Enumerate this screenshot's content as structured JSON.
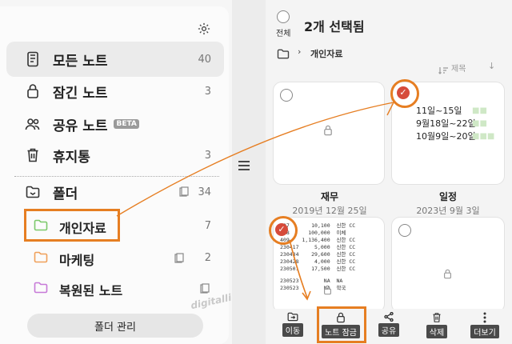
{
  "sidebar": {
    "items": [
      {
        "label": "모든 노트",
        "count": "40"
      },
      {
        "label": "잠긴 노트",
        "count": "3"
      },
      {
        "label": "공유 노트",
        "badge": "BETA"
      },
      {
        "label": "휴지통",
        "count": "3"
      }
    ],
    "folders_label": "폴더",
    "folders_count": "34",
    "folders": [
      {
        "label": "개인자료",
        "count": "7",
        "color": "#7cc96b"
      },
      {
        "label": "마케팅",
        "count": "2",
        "color": "#f0a05a"
      },
      {
        "label": "복원된 노트",
        "count": "",
        "color": "#c77ad8"
      }
    ],
    "manage_button": "폴더 관리"
  },
  "header": {
    "select_all": "전체",
    "title": "2개 선택됨",
    "breadcrumb": "개인자료",
    "sort_label": "제목"
  },
  "notes": [
    {
      "title": "",
      "date": "",
      "locked": true,
      "selected": false
    },
    {
      "title": "재무",
      "date": "2019년 12월 25일",
      "lines": [
        "11일~15일",
        "9월18일~22일",
        "10월9일~20일"
      ],
      "selected": true
    },
    {
      "title": "일정",
      "date": "2023년 9월 3일",
      "selected": false
    },
    {
      "title": "",
      "date": "",
      "selected": true,
      "locked": true
    },
    {
      "title": "",
      "date": "",
      "selected": false,
      "locked": true
    }
  ],
  "table_text": [
    [
      "407",
      "10,100",
      "신한 CC"
    ],
    [
      "408",
      "100,000",
      "이체"
    ],
    [
      "409",
      "1,136,400",
      "신한 CC"
    ],
    [
      "230417",
      "5,000",
      "신한 CC"
    ],
    [
      "230434",
      "29,600",
      "신한 CC"
    ],
    [
      "230428",
      "4,000",
      "신한 CC"
    ],
    [
      "230501",
      "17,500",
      "신한 CC"
    ],
    [
      "230523",
      "NA",
      "NA"
    ],
    [
      "230523",
      "NA",
      "학국"
    ]
  ],
  "bottom_bar": [
    {
      "label": "이동"
    },
    {
      "label": "노트 잠금"
    },
    {
      "label": "공유"
    },
    {
      "label": "삭제"
    },
    {
      "label": "더보기"
    }
  ],
  "watermark": "digitalli",
  "accent": "#e67e22"
}
